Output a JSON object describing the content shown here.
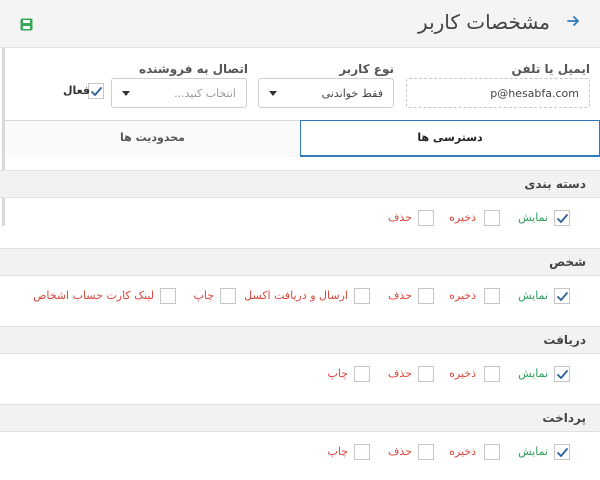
{
  "header": {
    "title": "مشخصات کاربر",
    "back_icon": "arrow-right-icon",
    "save_icon": "save-icon",
    "accent_color": "#2f79bd",
    "save_color": "#3aa757"
  },
  "form": {
    "email_label": "ایمیل یا تلفن",
    "email_value": "p@hesabfa.com",
    "user_type_label": "نوع کاربر",
    "user_type_value": "فقط خواندنی",
    "seller_label": "اتصال به فروشنده",
    "seller_placeholder": "انتخاب کنید...",
    "active_label": "فعال",
    "active_checked": true
  },
  "tabs": {
    "access_label": "دسترسی ها",
    "limits_label": "محدودیت ها"
  },
  "sections": [
    {
      "title": "دسته بندی",
      "permissions": [
        {
          "label": "نمایش",
          "checked": true,
          "color": "green"
        },
        {
          "label": "ذخیره",
          "checked": false,
          "color": "red"
        },
        {
          "label": "حذف",
          "checked": false,
          "color": "red"
        }
      ]
    },
    {
      "title": "شخص",
      "permissions": [
        {
          "label": "نمایش",
          "checked": true,
          "color": "green"
        },
        {
          "label": "ذخیره",
          "checked": false,
          "color": "red"
        },
        {
          "label": "حذف",
          "checked": false,
          "color": "red"
        },
        {
          "label": "ارسال و دریافت اکسل",
          "checked": false,
          "color": "red"
        },
        {
          "label": "چاپ",
          "checked": false,
          "color": "red"
        },
        {
          "label": "لینک کارت حساب اشخاص",
          "checked": false,
          "color": "red"
        }
      ]
    },
    {
      "title": "دریافت",
      "permissions": [
        {
          "label": "نمایش",
          "checked": true,
          "color": "green"
        },
        {
          "label": "ذخیره",
          "checked": false,
          "color": "red"
        },
        {
          "label": "حذف",
          "checked": false,
          "color": "red"
        },
        {
          "label": "چاپ",
          "checked": false,
          "color": "red"
        }
      ]
    },
    {
      "title": "پرداخت",
      "permissions": [
        {
          "label": "نمایش",
          "checked": true,
          "color": "green"
        },
        {
          "label": "ذخیره",
          "checked": false,
          "color": "red"
        },
        {
          "label": "حذف",
          "checked": false,
          "color": "red"
        },
        {
          "label": "چاپ",
          "checked": false,
          "color": "red"
        }
      ]
    }
  ]
}
